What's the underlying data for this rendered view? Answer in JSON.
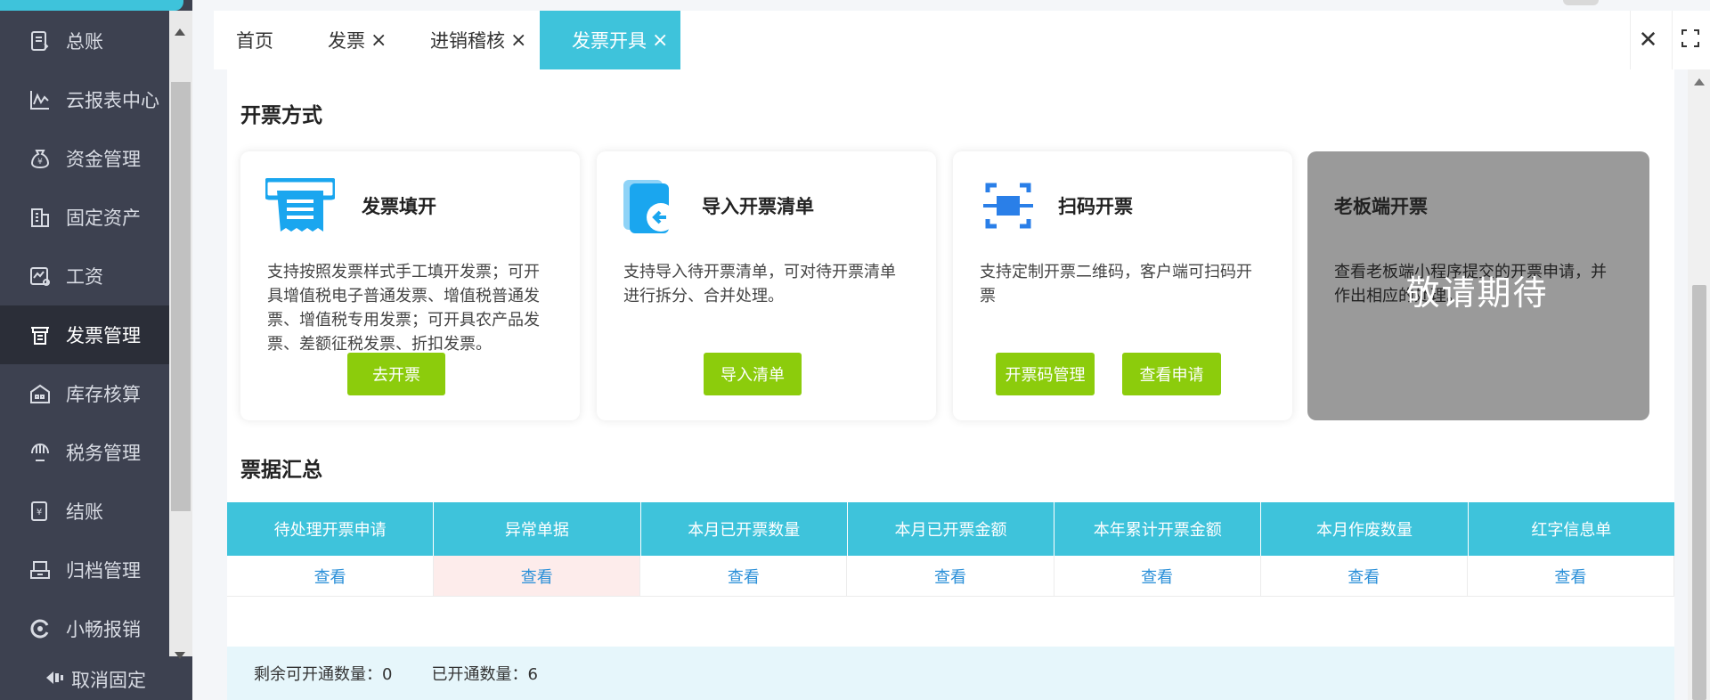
{
  "sidebar": {
    "items": [
      {
        "label": "总账",
        "icon": "ledger-icon"
      },
      {
        "label": "云报表中心",
        "icon": "chart-line-icon"
      },
      {
        "label": "资金管理",
        "icon": "money-bag-icon"
      },
      {
        "label": "固定资产",
        "icon": "building-icon"
      },
      {
        "label": "工资",
        "icon": "salary-icon"
      },
      {
        "label": "发票管理",
        "icon": "invoice-icon",
        "active": true
      },
      {
        "label": "库存核算",
        "icon": "warehouse-icon"
      },
      {
        "label": "税务管理",
        "icon": "tax-icon"
      },
      {
        "label": "结账",
        "icon": "closing-icon"
      },
      {
        "label": "归档管理",
        "icon": "archive-icon"
      },
      {
        "label": "小畅报销",
        "icon": "reimburse-icon"
      }
    ],
    "unpin_label": "取消固定"
  },
  "tabs": [
    {
      "label": "首页",
      "closable": false
    },
    {
      "label": "发票",
      "closable": true
    },
    {
      "label": "进销稽核",
      "closable": true
    },
    {
      "label": "发票开具",
      "closable": true,
      "active": true
    }
  ],
  "window": {
    "close_glyph": "✕",
    "fullscreen_glyph": "⛶"
  },
  "section1_title": "开票方式",
  "cards": [
    {
      "title": "发票填开",
      "desc": "支持按照发票样式手工填开发票；可开具增值税电子普通发票、增值税普通发票、增值税专用发票；可开具农产品发票、差额征税发票、折扣发票。",
      "buttons": [
        "去开票"
      ]
    },
    {
      "title": "导入开票清单",
      "desc": "支持导入待开票清单，可对待开票清单进行拆分、合并处理。",
      "buttons": [
        "导入清单"
      ]
    },
    {
      "title": "扫码开票",
      "desc": "支持定制开票二维码，客户端可扫码开票",
      "buttons": [
        "开票码管理",
        "查看申请"
      ]
    },
    {
      "title": "老板端开票",
      "desc": "查看老板端小程序提交的开票申请，并作出相应的处理。",
      "overlay": "敬请期待"
    }
  ],
  "section2_title": "票据汇总",
  "table": {
    "headers": [
      "待处理开票申请",
      "异常单据",
      "本月已开票数量",
      "本月已开票金额",
      "本年累计开票金额",
      "本月作废数量",
      "红字信息单"
    ],
    "row": [
      "查看",
      "查看",
      "查看",
      "查看",
      "查看",
      "查看",
      "查看"
    ]
  },
  "footer": {
    "remaining": "剩余可开通数量：0",
    "opened": "已开通数量：6"
  },
  "colors": {
    "accent": "#3ec3db",
    "green": "#8ccc0c",
    "sidebar": "#3d4150",
    "link": "#2a8fd8"
  }
}
